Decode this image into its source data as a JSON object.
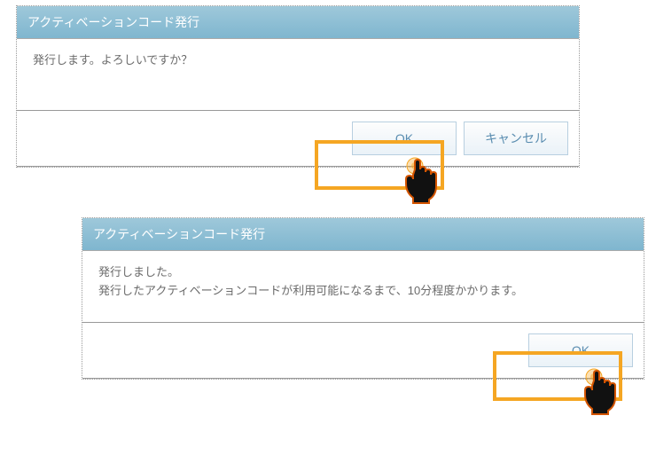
{
  "dialog1": {
    "title": "アクティベーションコード発行",
    "message": "発行します。よろしいですか？",
    "ok_label": "OK",
    "cancel_label": "キャンセル"
  },
  "dialog2": {
    "title": "アクティベーションコード発行",
    "message_line1": "発行しました。",
    "message_line2": "発行したアクティベーションコードが利用可能になるまで、10分程度かかります。",
    "ok_label": "OK"
  }
}
